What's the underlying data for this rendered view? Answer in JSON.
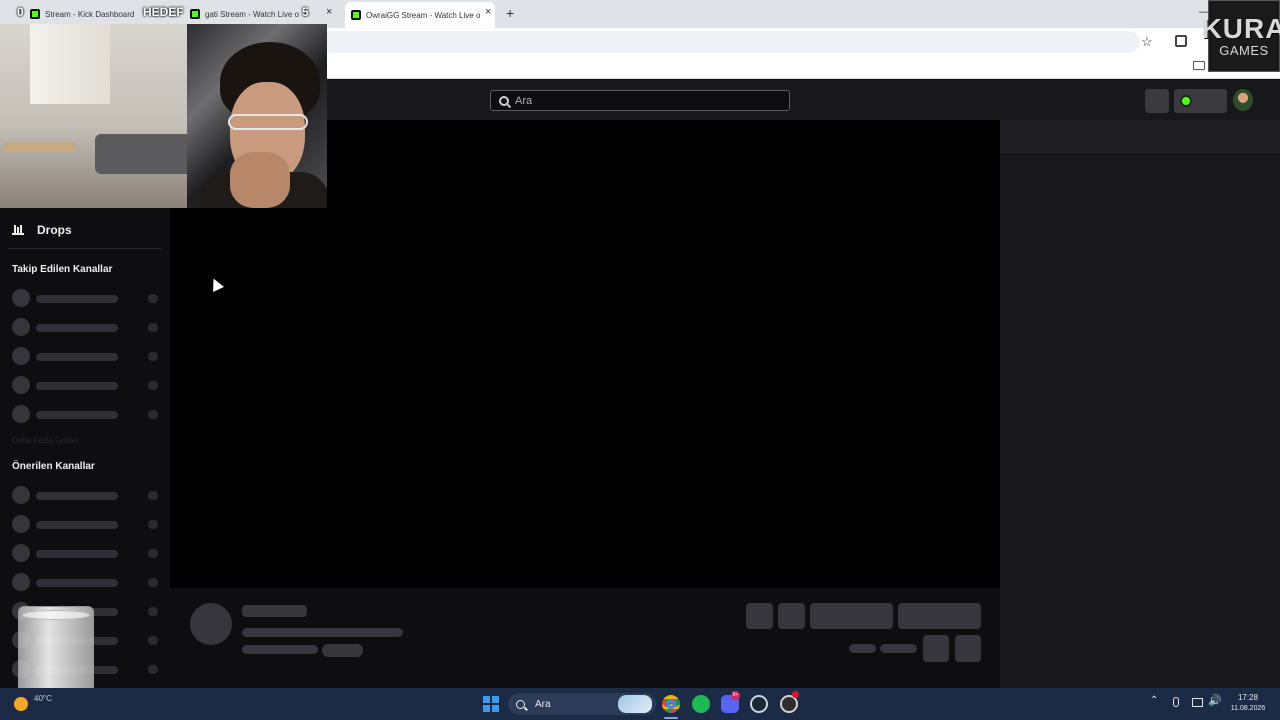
{
  "browser": {
    "tabs": [
      {
        "label": "Stream - Kick Dashboard"
      },
      {
        "label": "gati Stream - Watch Live o"
      },
      {
        "label": "OwraiGG Stream - Watch Live o"
      }
    ],
    "tab_close": "×",
    "new_tab": "+",
    "minimize": "—",
    "star": "☆"
  },
  "overlay": {
    "left_counter": "0",
    "goal_label": "HEDEF",
    "right_counter": "5"
  },
  "logo": {
    "top": "KURA",
    "bottom": "GAMES"
  },
  "header": {
    "search_placeholder": "Ara"
  },
  "sidebar": {
    "drops_label": "Drops",
    "followed_title": "Takip Edilen Kanallar",
    "faded_text": "Daha Fazla Göster",
    "recommended_title": "Önerilen Kanallar"
  },
  "taskbar": {
    "weather_temp": "40°C",
    "search_label": "Ara",
    "discord_badge": "9+",
    "tray_chevron": "⌃",
    "volume": "🔊",
    "time": "17:28",
    "date": "11.08.2026"
  },
  "colors": {
    "kick_green": "#53fc18",
    "site_bg": "#0e0e10",
    "header_bg": "#18181b",
    "taskbar_bg": "#1c2b45"
  }
}
